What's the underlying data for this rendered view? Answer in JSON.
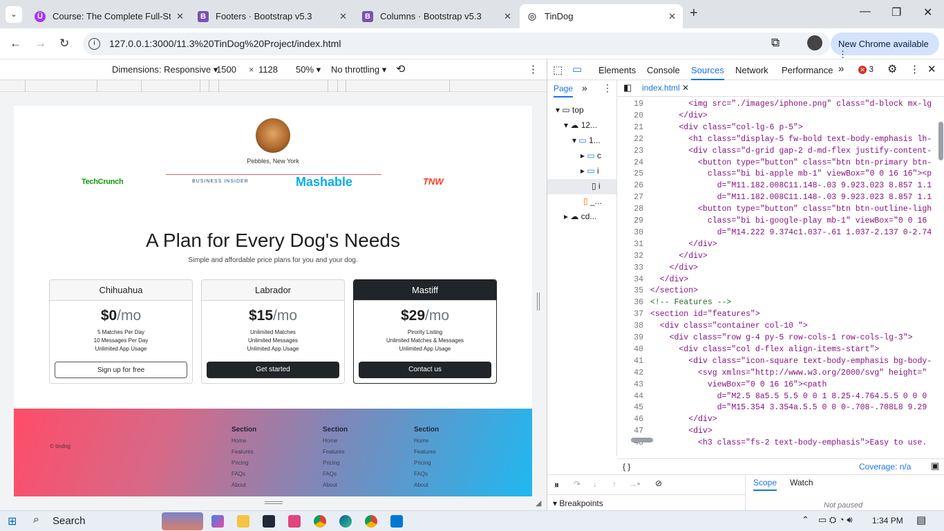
{
  "browser": {
    "tabs": [
      {
        "title": "Course: The Complete Full-Stac",
        "icon": "udemy-icon",
        "color": "#a435f0",
        "glyph": "Ü"
      },
      {
        "title": "Footers · Bootstrap v5.3",
        "icon": "bootstrap-icon",
        "color": "#7952b3",
        "glyph": "B"
      },
      {
        "title": "Columns · Bootstrap v5.3",
        "icon": "bootstrap-icon",
        "color": "#7952b3",
        "glyph": "B"
      },
      {
        "title": "TinDog",
        "icon": "globe-icon",
        "color": "#5f6368",
        "glyph": "◎"
      }
    ],
    "url": "127.0.0.1:3000/11.3%20TinDog%20Project/index.html",
    "new_chrome": "New Chrome available"
  },
  "device_toolbar": {
    "dimensions_label": "Dimensions: Responsive",
    "width": "1500",
    "times": "×",
    "height": "1128",
    "zoom": "50%",
    "throttle": "No throttling"
  },
  "page": {
    "testimonial_name": "Pebbles, New York",
    "logos": [
      "TechCrunch",
      "BUSINESS INSIDER",
      "Mashable",
      "TNW"
    ],
    "pricing_title": "A Plan for Every Dog's Needs",
    "pricing_subtitle": "Simple and affordable price plans for you and your dog.",
    "plans": [
      {
        "name": "Chihuahua",
        "price": "$0",
        "per": "/mo",
        "features": [
          "5 Matches Per Day",
          "10 Messages Per Day",
          "Unlimited App Usage"
        ],
        "button": "Sign up for free"
      },
      {
        "name": "Labrador",
        "price": "$15",
        "per": "/mo",
        "features": [
          "Unlimited Matches",
          "Unlimited Messages",
          "Unlimited App Usage"
        ],
        "button": "Get started"
      },
      {
        "name": "Mastiff",
        "price": "$29",
        "per": "/mo",
        "features": [
          "Pirority Listing",
          "Unlimited Matches & Messages",
          "Unlimited App Usage"
        ],
        "button": "Contact us"
      }
    ],
    "footer": {
      "copyright": "© tindog",
      "columns": [
        {
          "heading": "Section",
          "links": [
            "Home",
            "Features",
            "Pricing",
            "FAQs",
            "About"
          ]
        },
        {
          "heading": "Section",
          "links": [
            "Home",
            "Features",
            "Pricing",
            "FAQs",
            "About"
          ]
        },
        {
          "heading": "Section",
          "links": [
            "Home",
            "Features",
            "Pricing",
            "FAQs",
            "About"
          ]
        }
      ]
    }
  },
  "devtools": {
    "tabs": [
      "Elements",
      "Console",
      "Sources",
      "Network",
      "Performance"
    ],
    "active_tab": "Sources",
    "error_count": "3",
    "nav_tab": "Page",
    "tree": [
      "top",
      "12...",
      "1...",
      "c",
      "i",
      "i",
      "_...",
      "cd..."
    ],
    "open_file": "index.html",
    "code_lines": [
      {
        "n": "19",
        "t": "        <img src=\"./images/iphone.png\" class=\"d-block mx-lg"
      },
      {
        "n": "20",
        "t": "      </div>"
      },
      {
        "n": "21",
        "t": "      <div class=\"col-lg-6 p-5\">"
      },
      {
        "n": "22",
        "t": "        <h1 class=\"display-5 fw-bold text-body-emphasis lh-"
      },
      {
        "n": "23",
        "t": "        <div class=\"d-grid gap-2 d-md-flex justify-content-"
      },
      {
        "n": "24",
        "t": "          <button type=\"button\" class=\"btn btn-primary btn-"
      },
      {
        "n": "25",
        "t": "            class=\"bi bi-apple mb-1\" viewBox=\"0 0 16 16\"><p"
      },
      {
        "n": "26",
        "t": "              d=\"M11.182.008C11.148-.03 9.923.023 8.857 1.1"
      },
      {
        "n": "27",
        "t": "              d=\"M11.182.008C11.148-.03 9.923.023 8.857 1.1"
      },
      {
        "n": "28",
        "t": "          <button type=\"button\" class=\"btn btn-outline-ligh"
      },
      {
        "n": "29",
        "t": "            class=\"bi bi-google-play mb-1\" viewBox=\"0 0 16"
      },
      {
        "n": "30",
        "t": "              d=\"M14.222 9.374c1.037-.61 1.037-2.137 0-2.74"
      },
      {
        "n": "31",
        "t": "        </div>"
      },
      {
        "n": "32",
        "t": "      </div>"
      },
      {
        "n": "33",
        "t": "    </div>"
      },
      {
        "n": "34",
        "t": "  </div>"
      },
      {
        "n": "35",
        "t": "</section>"
      },
      {
        "n": "36",
        "t": "<!-- Features -->"
      },
      {
        "n": "37",
        "t": "<section id=\"features\">"
      },
      {
        "n": "38",
        "t": "  <div class=\"container col-10 \">"
      },
      {
        "n": "39",
        "t": "    <div class=\"row g-4 py-5 row-cols-1 row-cols-lg-3\">"
      },
      {
        "n": "40",
        "t": "      <div class=\"col d-flex align-items-start\">"
      },
      {
        "n": "41",
        "t": "        <div class=\"icon-square text-body-emphasis bg-body-"
      },
      {
        "n": "42",
        "t": "          <svg xmlns=\"http://www.w3.org/2000/svg\" height=\""
      },
      {
        "n": "43",
        "t": "            viewBox=\"0 0 16 16\"><path"
      },
      {
        "n": "44",
        "t": "              d=\"M2.5 8a5.5 5.5 0 0 1 8.25-4.764.5.5 0 0 0"
      },
      {
        "n": "45",
        "t": "              d=\"M15.354 3.354a.5.5 0 0 0-.708-.708L8 9.29"
      },
      {
        "n": "46",
        "t": "        </div>"
      },
      {
        "n": "47",
        "t": "        <div>"
      },
      {
        "n": "48",
        "t": "          <h3 class=\"fs-2 text-body-emphasis\">Easy to use."
      }
    ],
    "braces": "{ }",
    "coverage": "Coverage: n/a",
    "breakpoints": "Breakpoints",
    "scope": "Scope",
    "watch": "Watch",
    "not_paused": "Not paused"
  },
  "taskbar": {
    "search": "Search",
    "time": "1:34 PM"
  }
}
